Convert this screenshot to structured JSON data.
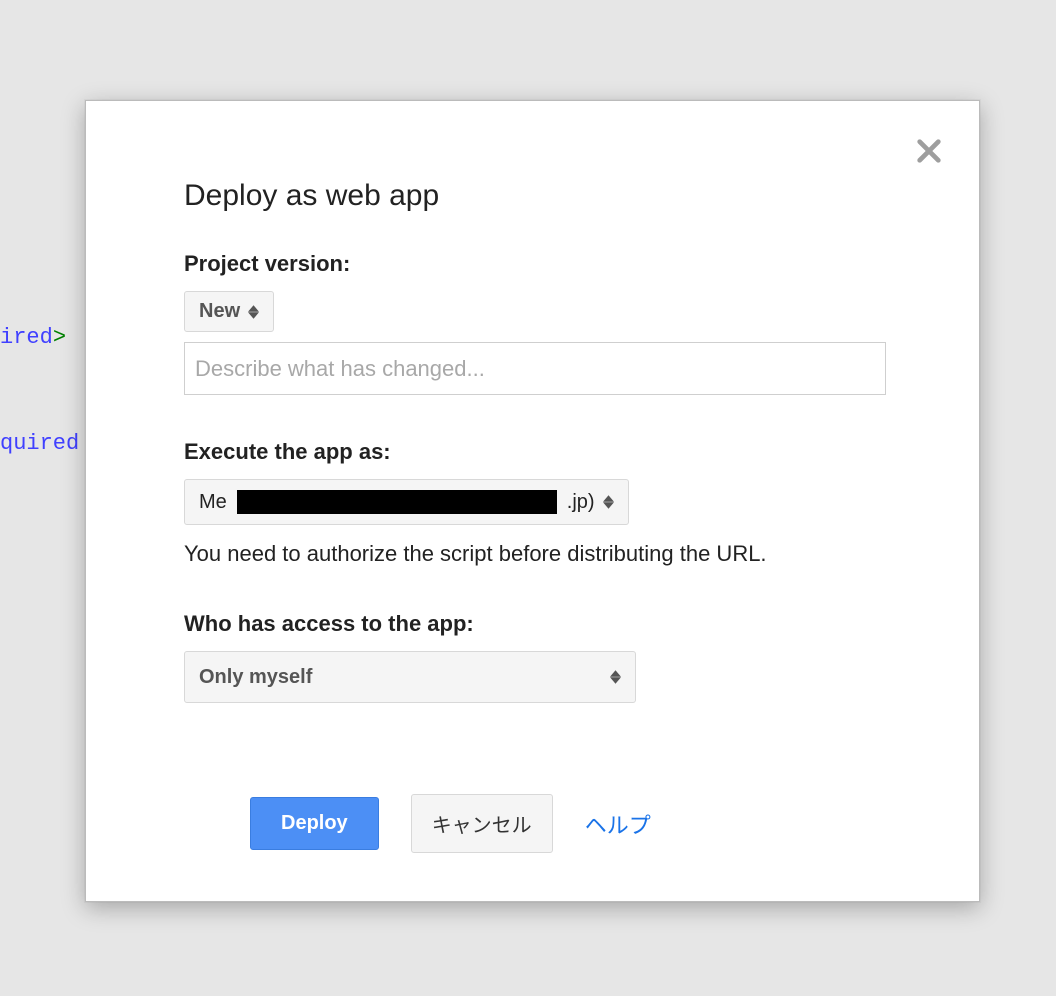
{
  "background": {
    "line1_text": "ired",
    "line1_gt": ">",
    "line2_text": "quired"
  },
  "dialog": {
    "title": "Deploy as web app",
    "project_version": {
      "label": "Project version:",
      "selected": "New",
      "description_placeholder": "Describe what has changed..."
    },
    "execute_as": {
      "label": "Execute the app as:",
      "selected_prefix": "Me ",
      "selected_suffix": ".jp)",
      "helper": "You need to authorize the script before distributing the URL."
    },
    "access": {
      "label": "Who has access to the app:",
      "selected": "Only myself"
    },
    "buttons": {
      "deploy": "Deploy",
      "cancel": "キャンセル",
      "help": "ヘルプ"
    }
  }
}
